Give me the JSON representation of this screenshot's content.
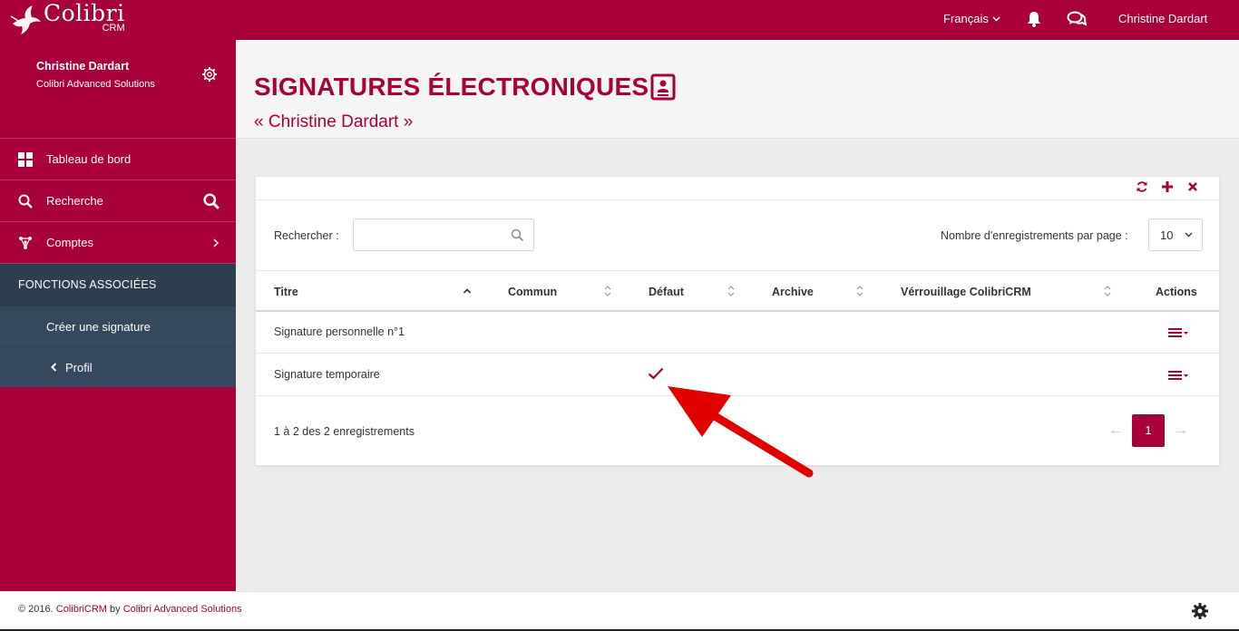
{
  "topbar": {
    "logo_main": "Colibri",
    "logo_sub": "CRM",
    "language": "Français",
    "user_name": "Christine Dardart"
  },
  "sidebar": {
    "profile_name": "Christine Dardart",
    "profile_company": "Colibri Advanced Solutions",
    "items": [
      {
        "label": "Tableau de bord",
        "icon": "dashboard-icon"
      },
      {
        "label": "Recherche",
        "icon": "search-icon"
      },
      {
        "label": "Comptes",
        "icon": "accounts-icon"
      }
    ],
    "section_title": "FONCTIONS ASSOCIÉES",
    "sub_items": [
      {
        "label": "Créer une signature"
      },
      {
        "label": "Profil"
      }
    ]
  },
  "page": {
    "title": "SIGNATURES ÉLECTRONIQUES",
    "subtitle": "« Christine Dardart »"
  },
  "panel": {
    "search_label": "Rechercher :",
    "search_value": "",
    "per_page_label": "Nombre d'enregistrements par page :",
    "per_page_value": "10",
    "columns": [
      "Titre",
      "Commun",
      "Défaut",
      "Archive",
      "Vérrouillage ColibriCRM",
      "Actions"
    ],
    "rows": [
      {
        "titre": "Signature personnelle n°1",
        "commun": "",
        "defaut": false,
        "archive": "",
        "verrouillage": ""
      },
      {
        "titre": "Signature temporaire",
        "commun": "",
        "defaut": true,
        "archive": "",
        "verrouillage": ""
      }
    ],
    "info": "1 à 2 des 2 enregistrements",
    "pagination": {
      "prev": "←",
      "current": "1",
      "next": "→"
    }
  },
  "footer": {
    "copyright": "© 2016. ",
    "brand": "ColibriCRM",
    "by": " by ",
    "company": "Colibri Advanced Solutions"
  },
  "colors": {
    "brand": "#a8003a",
    "sidebar_dark": "#2c3e50",
    "sidebar_sub": "#34495e",
    "annotation": "#e00000"
  }
}
